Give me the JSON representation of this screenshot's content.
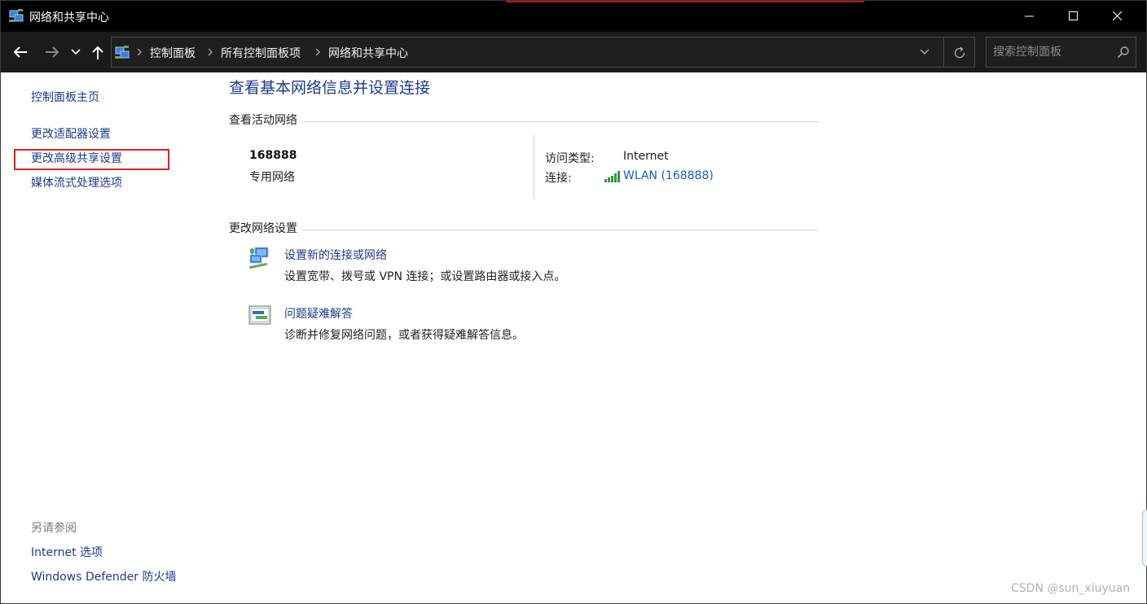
{
  "window": {
    "title": "网络和共享中心"
  },
  "address_bar": {
    "crumbs": [
      "控制面板",
      "所有控制面板项",
      "网络和共享中心"
    ]
  },
  "search": {
    "placeholder": "搜索控制面板"
  },
  "left_pane": {
    "links": [
      "控制面板主页",
      "更改适配器设置",
      "更改高级共享设置",
      "媒体流式处理选项"
    ],
    "see_also_heading": "另请参阅",
    "see_also_links": [
      "Internet 选项",
      "Windows Defender 防火墙"
    ]
  },
  "main": {
    "title": "查看基本网络信息并设置连接",
    "active_networks": {
      "heading": "查看活动网络",
      "network_name": "168888",
      "network_type": "专用网络",
      "access_type_label": "访问类型:",
      "access_type_value": "Internet",
      "connection_label": "连接:",
      "connection_value": "WLAN (168888)"
    },
    "change_settings": {
      "heading": "更改网络设置",
      "tasks": [
        {
          "title": "设置新的连接或网络",
          "description": "设置宽带、拨号或 VPN 连接；或设置路由器或接入点。",
          "icon": "network-setup-icon"
        },
        {
          "title": "问题疑难解答",
          "description": "诊断并修复网络问题，或者获得疑难解答信息。",
          "icon": "troubleshoot-icon"
        }
      ]
    }
  },
  "watermark": "CSDN @sun_xiuyuan",
  "colors": {
    "link": "#1a3c8c",
    "title_blue": "#1d3b8f",
    "highlight_red": "#e02020",
    "titlebar": "#000000"
  }
}
